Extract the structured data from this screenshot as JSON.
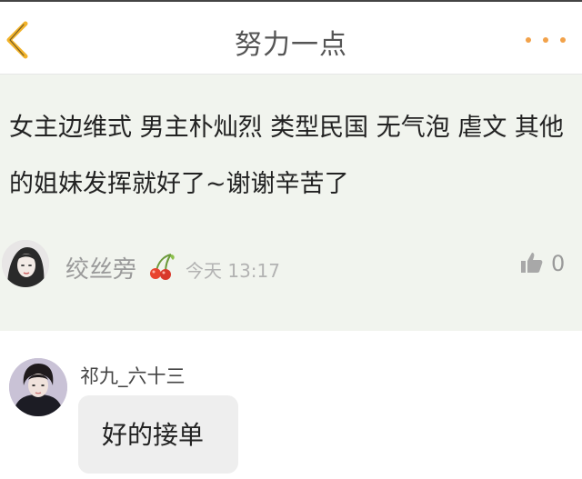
{
  "header": {
    "title": "努力一点",
    "back_icon": "chevron-left-icon",
    "more_icon": "more-dots-icon",
    "accent_color": "#f2a24a"
  },
  "post": {
    "content": "女主边维式 男主朴灿烈 类型民国 无气泡 虐文 其他的姐妹发挥就好了~谢谢辛苦了",
    "author": "绞丝旁",
    "badge_icon": "cherry-icon",
    "time": "今天 13:17",
    "like_icon": "thumbs-up-icon",
    "like_count": "0",
    "background_color": "#f1f4ee"
  },
  "reply": {
    "author": "祁九_六十三",
    "message": "好的接单"
  }
}
